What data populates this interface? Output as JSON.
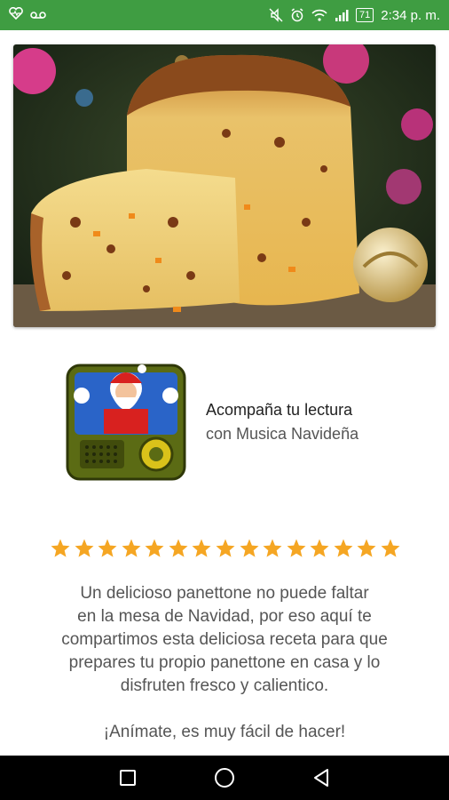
{
  "status_bar": {
    "time": "2:34 p. m.",
    "battery": "71",
    "icons": [
      "heartbeat-icon",
      "voicemail-icon",
      "mute-icon",
      "alarm-icon",
      "wifi-icon",
      "signal-icon",
      "battery-icon"
    ]
  },
  "hero_image": {
    "description_icon": "panettone-photo"
  },
  "promo": {
    "line1": "Acompaña tu lectura",
    "line2": "con Musica Navideña",
    "icon": "santa-radio-icon"
  },
  "rating": {
    "stars": 15,
    "color": "#f5a623"
  },
  "description": {
    "lines": [
      "Un delicioso panettone no puede faltar",
      "en la mesa de Navidad, por eso aquí te",
      "compartimos esta deliciosa receta para que",
      "prepares tu propio panettone en casa y lo",
      "disfruten fresco y calientico."
    ],
    "cta": "¡Anímate, es muy fácil de hacer!"
  },
  "nav": {
    "icons": [
      "recents-icon",
      "home-icon",
      "back-icon"
    ]
  },
  "colors": {
    "status_bar": "#3f9d42",
    "nav_bar": "#000000"
  }
}
